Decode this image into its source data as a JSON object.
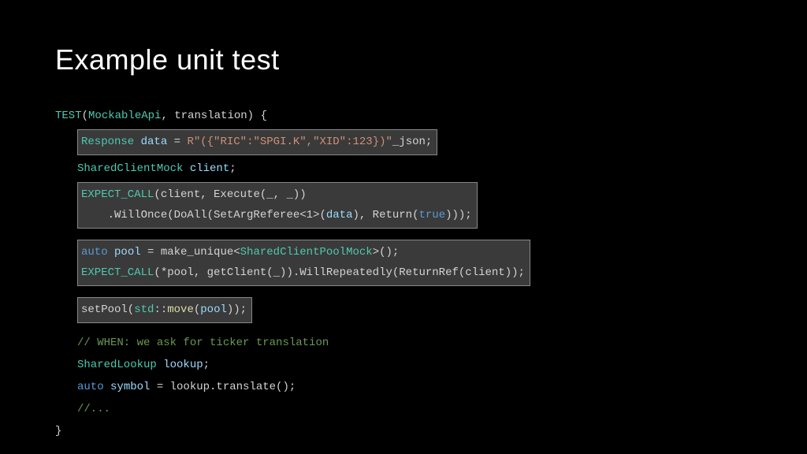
{
  "title": "Example unit test",
  "code": {
    "l1_test": "TEST",
    "l1_punct0": "(",
    "l1_arg1": "MockableApi",
    "l1_punct1": ", translation) {",
    "l2_type": "Response",
    "l2_var": " data",
    "l2_eq": " = ",
    "l2_str": "R\"({\"RIC\":\"SPGI.K\",\"XID\":123})\"",
    "l2_suffix": "_json",
    "l2_end": ";",
    "l3_type": "SharedClientMock",
    "l3_var": " client",
    "l3_end": ";",
    "l4_1_call": "EXPECT_CALL",
    "l4_1_rest": "(client, Execute(_, _))",
    "l4_2_pre": "    .WillOnce(DoAll(SetArgReferee<1>(",
    "l4_2_var": "data",
    "l4_2_mid": "), Return(",
    "l4_2_bool": "true",
    "l4_2_end": ")));",
    "l5_1_kw": "auto",
    "l5_1_var": " pool",
    "l5_1_mid": " = make_unique<",
    "l5_1_type": "SharedClientPoolMock",
    "l5_1_end": ">();",
    "l5_2_call": "EXPECT_CALL",
    "l5_2_rest": "(*pool, getClient(_)).WillRepeatedly(ReturnRef(client));",
    "l6_pre": "setPool(",
    "l6_ns": "std",
    "l6_op": "::",
    "l6_member": "move",
    "l6_p0": "(",
    "l6_var": "pool",
    "l6_end": "));",
    "l7_comment": "// WHEN: we ask for ticker translation",
    "l8_type": "SharedLookup",
    "l8_var": " lookup",
    "l8_end": ";",
    "l9_kw": "auto",
    "l9_var": " symbol",
    "l9_rest": " = lookup.translate();",
    "l10_comment": "//...",
    "l11": "}"
  }
}
